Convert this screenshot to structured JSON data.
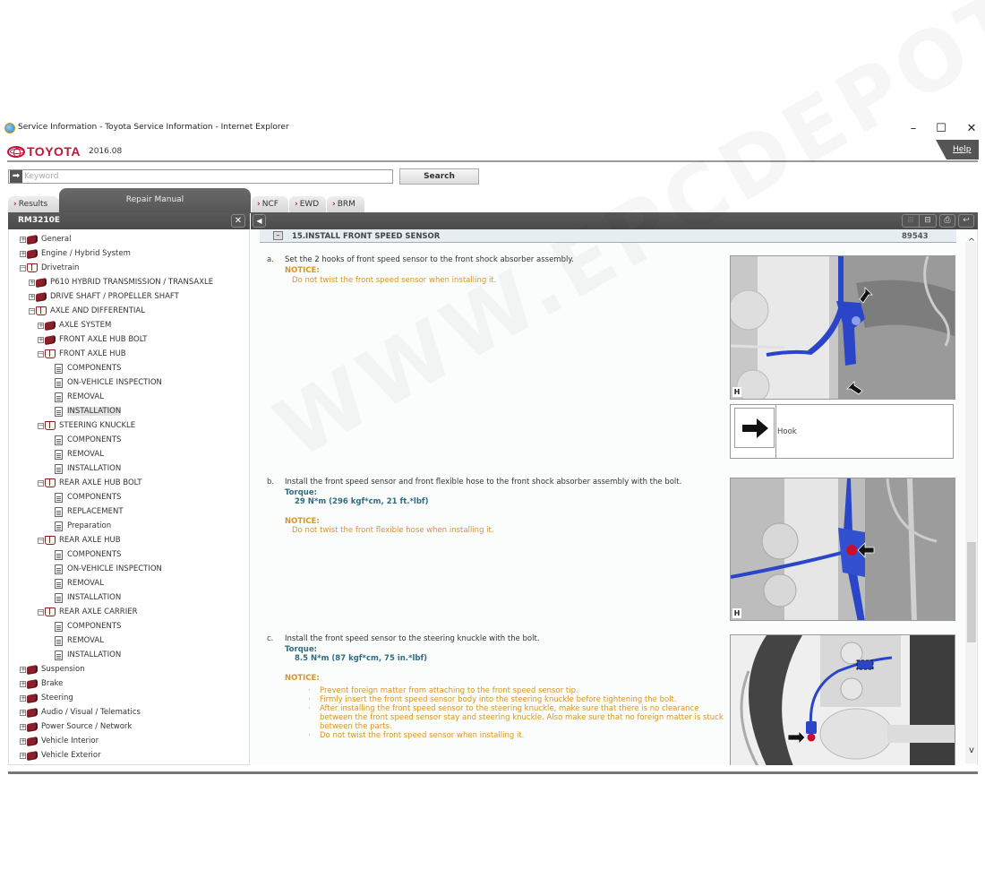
{
  "window": {
    "title": "Service Information - Toyota Service Information - Internet Explorer",
    "minimize": "–",
    "maximize": "☐",
    "close": "✕"
  },
  "header": {
    "brand": "TOYOTA",
    "version": "2016.08",
    "help_label": "Help",
    "brand_color": "#c0143c"
  },
  "search": {
    "placeholder": "Keyword",
    "value": "",
    "button_label": "Search",
    "arrow_icon": "➡"
  },
  "tabs": {
    "results": "Results",
    "repair_manual": "Repair Manual",
    "ncf": "NCF",
    "ewd": "EWD",
    "brm": "BRM"
  },
  "left_panel": {
    "title": "RM3210E",
    "close_icon": "✕",
    "tree": [
      {
        "label": "General",
        "level": 0,
        "type": "book",
        "expanded": false
      },
      {
        "label": "Engine / Hybrid System",
        "level": 0,
        "type": "book",
        "expanded": false
      },
      {
        "label": "Drivetrain",
        "level": 0,
        "type": "open-book",
        "expanded": true
      },
      {
        "label": "P610 HYBRID TRANSMISSION / TRANSAXLE",
        "level": 1,
        "type": "book",
        "expanded": false
      },
      {
        "label": "DRIVE SHAFT / PROPELLER SHAFT",
        "level": 1,
        "type": "book",
        "expanded": false
      },
      {
        "label": "AXLE AND DIFFERENTIAL",
        "level": 1,
        "type": "open-book",
        "expanded": true
      },
      {
        "label": "AXLE SYSTEM",
        "level": 2,
        "type": "book",
        "expanded": false
      },
      {
        "label": "FRONT AXLE HUB BOLT",
        "level": 2,
        "type": "book",
        "expanded": false
      },
      {
        "label": "FRONT AXLE HUB",
        "level": 2,
        "type": "open-book",
        "expanded": true
      },
      {
        "label": "COMPONENTS",
        "level": 3,
        "type": "doc"
      },
      {
        "label": "ON-VEHICLE INSPECTION",
        "level": 3,
        "type": "doc"
      },
      {
        "label": "REMOVAL",
        "level": 3,
        "type": "doc"
      },
      {
        "label": "INSTALLATION",
        "level": 3,
        "type": "doc",
        "selected": true
      },
      {
        "label": "STEERING KNUCKLE",
        "level": 2,
        "type": "open-book",
        "expanded": true
      },
      {
        "label": "COMPONENTS",
        "level": 3,
        "type": "doc"
      },
      {
        "label": "REMOVAL",
        "level": 3,
        "type": "doc"
      },
      {
        "label": "INSTALLATION",
        "level": 3,
        "type": "doc"
      },
      {
        "label": "REAR AXLE HUB BOLT",
        "level": 2,
        "type": "open-book",
        "expanded": true
      },
      {
        "label": "COMPONENTS",
        "level": 3,
        "type": "doc"
      },
      {
        "label": "REPLACEMENT",
        "level": 3,
        "type": "doc"
      },
      {
        "label": "Preparation",
        "level": 3,
        "type": "doc"
      },
      {
        "label": "REAR AXLE HUB",
        "level": 2,
        "type": "open-book",
        "expanded": true
      },
      {
        "label": "COMPONENTS",
        "level": 3,
        "type": "doc"
      },
      {
        "label": "ON-VEHICLE INSPECTION",
        "level": 3,
        "type": "doc"
      },
      {
        "label": "REMOVAL",
        "level": 3,
        "type": "doc"
      },
      {
        "label": "INSTALLATION",
        "level": 3,
        "type": "doc"
      },
      {
        "label": "REAR AXLE CARRIER",
        "level": 2,
        "type": "open-book",
        "expanded": true
      },
      {
        "label": "COMPONENTS",
        "level": 3,
        "type": "doc"
      },
      {
        "label": "REMOVAL",
        "level": 3,
        "type": "doc"
      },
      {
        "label": "INSTALLATION",
        "level": 3,
        "type": "doc"
      },
      {
        "label": "Suspension",
        "level": 0,
        "type": "book",
        "expanded": false
      },
      {
        "label": "Brake",
        "level": 0,
        "type": "book",
        "expanded": false
      },
      {
        "label": "Steering",
        "level": 0,
        "type": "book",
        "expanded": false
      },
      {
        "label": "Audio / Visual / Telematics",
        "level": 0,
        "type": "book",
        "expanded": false
      },
      {
        "label": "Power Source / Network",
        "level": 0,
        "type": "book",
        "expanded": false
      },
      {
        "label": "Vehicle Interior",
        "level": 0,
        "type": "book",
        "expanded": false
      },
      {
        "label": "Vehicle Exterior",
        "level": 0,
        "type": "book",
        "expanded": false
      }
    ]
  },
  "content": {
    "section_title": "15.INSTALL FRONT SPEED SENSOR",
    "section_id": "89543",
    "steps": [
      {
        "label": "a.",
        "text": "Set the 2 hooks of front speed sensor to the front shock absorber assembly.",
        "notice_label": "NOTICE:",
        "notices": [
          "Do not twist the front speed sensor when installing it."
        ]
      },
      {
        "label": "b.",
        "text": "Install the front speed sensor and front flexible hose to the front shock absorber assembly with the bolt.",
        "torque_label": "Torque:",
        "torque_value": "29 N*m (296 kgf*cm, 21 ft.*lbf)",
        "notice_label": "NOTICE:",
        "notices": [
          "Do not twist the front flexible hose when installing it."
        ]
      },
      {
        "label": "c.",
        "text": "Install the front speed sensor to the steering knuckle with the bolt.",
        "torque_label": "Torque:",
        "torque_value": "8.5 N*m (87 kgf*cm, 75 in.*lbf)",
        "notice_label": "NOTICE:",
        "notices": [
          "Prevent foreign matter from attaching to the front speed sensor tip.",
          "Firmly insert the front speed sensor body into the steering knuckle before tightening the bolt.",
          "After installing the front speed sensor to the steering knuckle, make sure that there is no clearance between the front speed sensor stay and steering knuckle. Also make sure that no foreign matter is stuck between the parts.",
          "Do not twist the front speed sensor when installing it."
        ]
      }
    ],
    "figures": [
      {
        "corner_label": "H",
        "description": "front shock absorber with speed sensor hooks (blue) and 2 arrows"
      },
      {
        "corner_label": "H",
        "description": "front speed sensor and flexible hose bolt (red dot) with arrow"
      },
      {
        "corner_label": "",
        "description": "speed sensor at steering knuckle with bolt (red dot) and arrow"
      }
    ],
    "legend": {
      "icon": "arrow-right",
      "label": "Hook"
    }
  },
  "toolbar": {
    "collapse_left_icon": "◀",
    "expand_all_icon": "⊞",
    "collapse_all_icon": "⊟",
    "print_icon": "⎙",
    "back_icon": "↩"
  },
  "scroll": {
    "up": "^",
    "down": "v"
  },
  "watermark": "WWW.EPCDEPOT"
}
